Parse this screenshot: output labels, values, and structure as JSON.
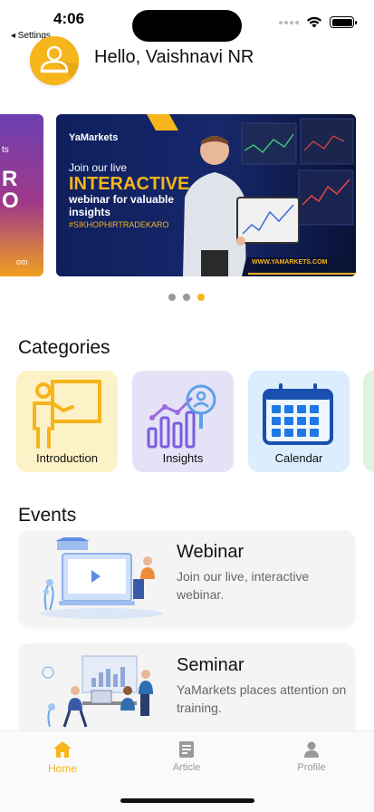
{
  "status_bar": {
    "time": "4:06",
    "back_app": "◂ Settings"
  },
  "header": {
    "greeting": "Hello, Vaishnavi NR",
    "avatar_icon": "user-avatar-icon"
  },
  "banners": {
    "previous": {
      "text_small": "ts",
      "text_big": "R\nO",
      "url_partial": "om"
    },
    "current": {
      "logo": "YaMarkets",
      "line1": "Join our live",
      "line2": "INTERACTIVE",
      "line3": "webinar for valuable insights",
      "hashtag": "#SIKHOPHIRTRADEKARO",
      "url": "WWW.YAMARKETS.COM"
    },
    "pager_active_index": 2,
    "pager_count": 3
  },
  "categories": {
    "title": "Categories",
    "items": [
      {
        "label": "Introduction",
        "icon": "presentation-board-icon",
        "bg": "#fdf1c7"
      },
      {
        "label": "Insights",
        "icon": "analytics-chart-icon",
        "bg": "#e4e2f6"
      },
      {
        "label": "Calendar",
        "icon": "calendar-icon",
        "bg": "#dcedfd"
      }
    ]
  },
  "events": {
    "title": "Events",
    "items": [
      {
        "title": "Webinar",
        "description": "Join our live, interactive webinar."
      },
      {
        "title": "Seminar",
        "description": "YaMarkets places attention on training."
      }
    ]
  },
  "tabbar": {
    "items": [
      {
        "label": "Home",
        "icon": "home-icon",
        "active": true
      },
      {
        "label": "Article",
        "icon": "article-icon",
        "active": false
      },
      {
        "label": "Profile",
        "icon": "profile-icon",
        "active": false
      }
    ]
  },
  "colors": {
    "accent": "#f5b51b",
    "banner_bg": "#0f1f5e"
  }
}
